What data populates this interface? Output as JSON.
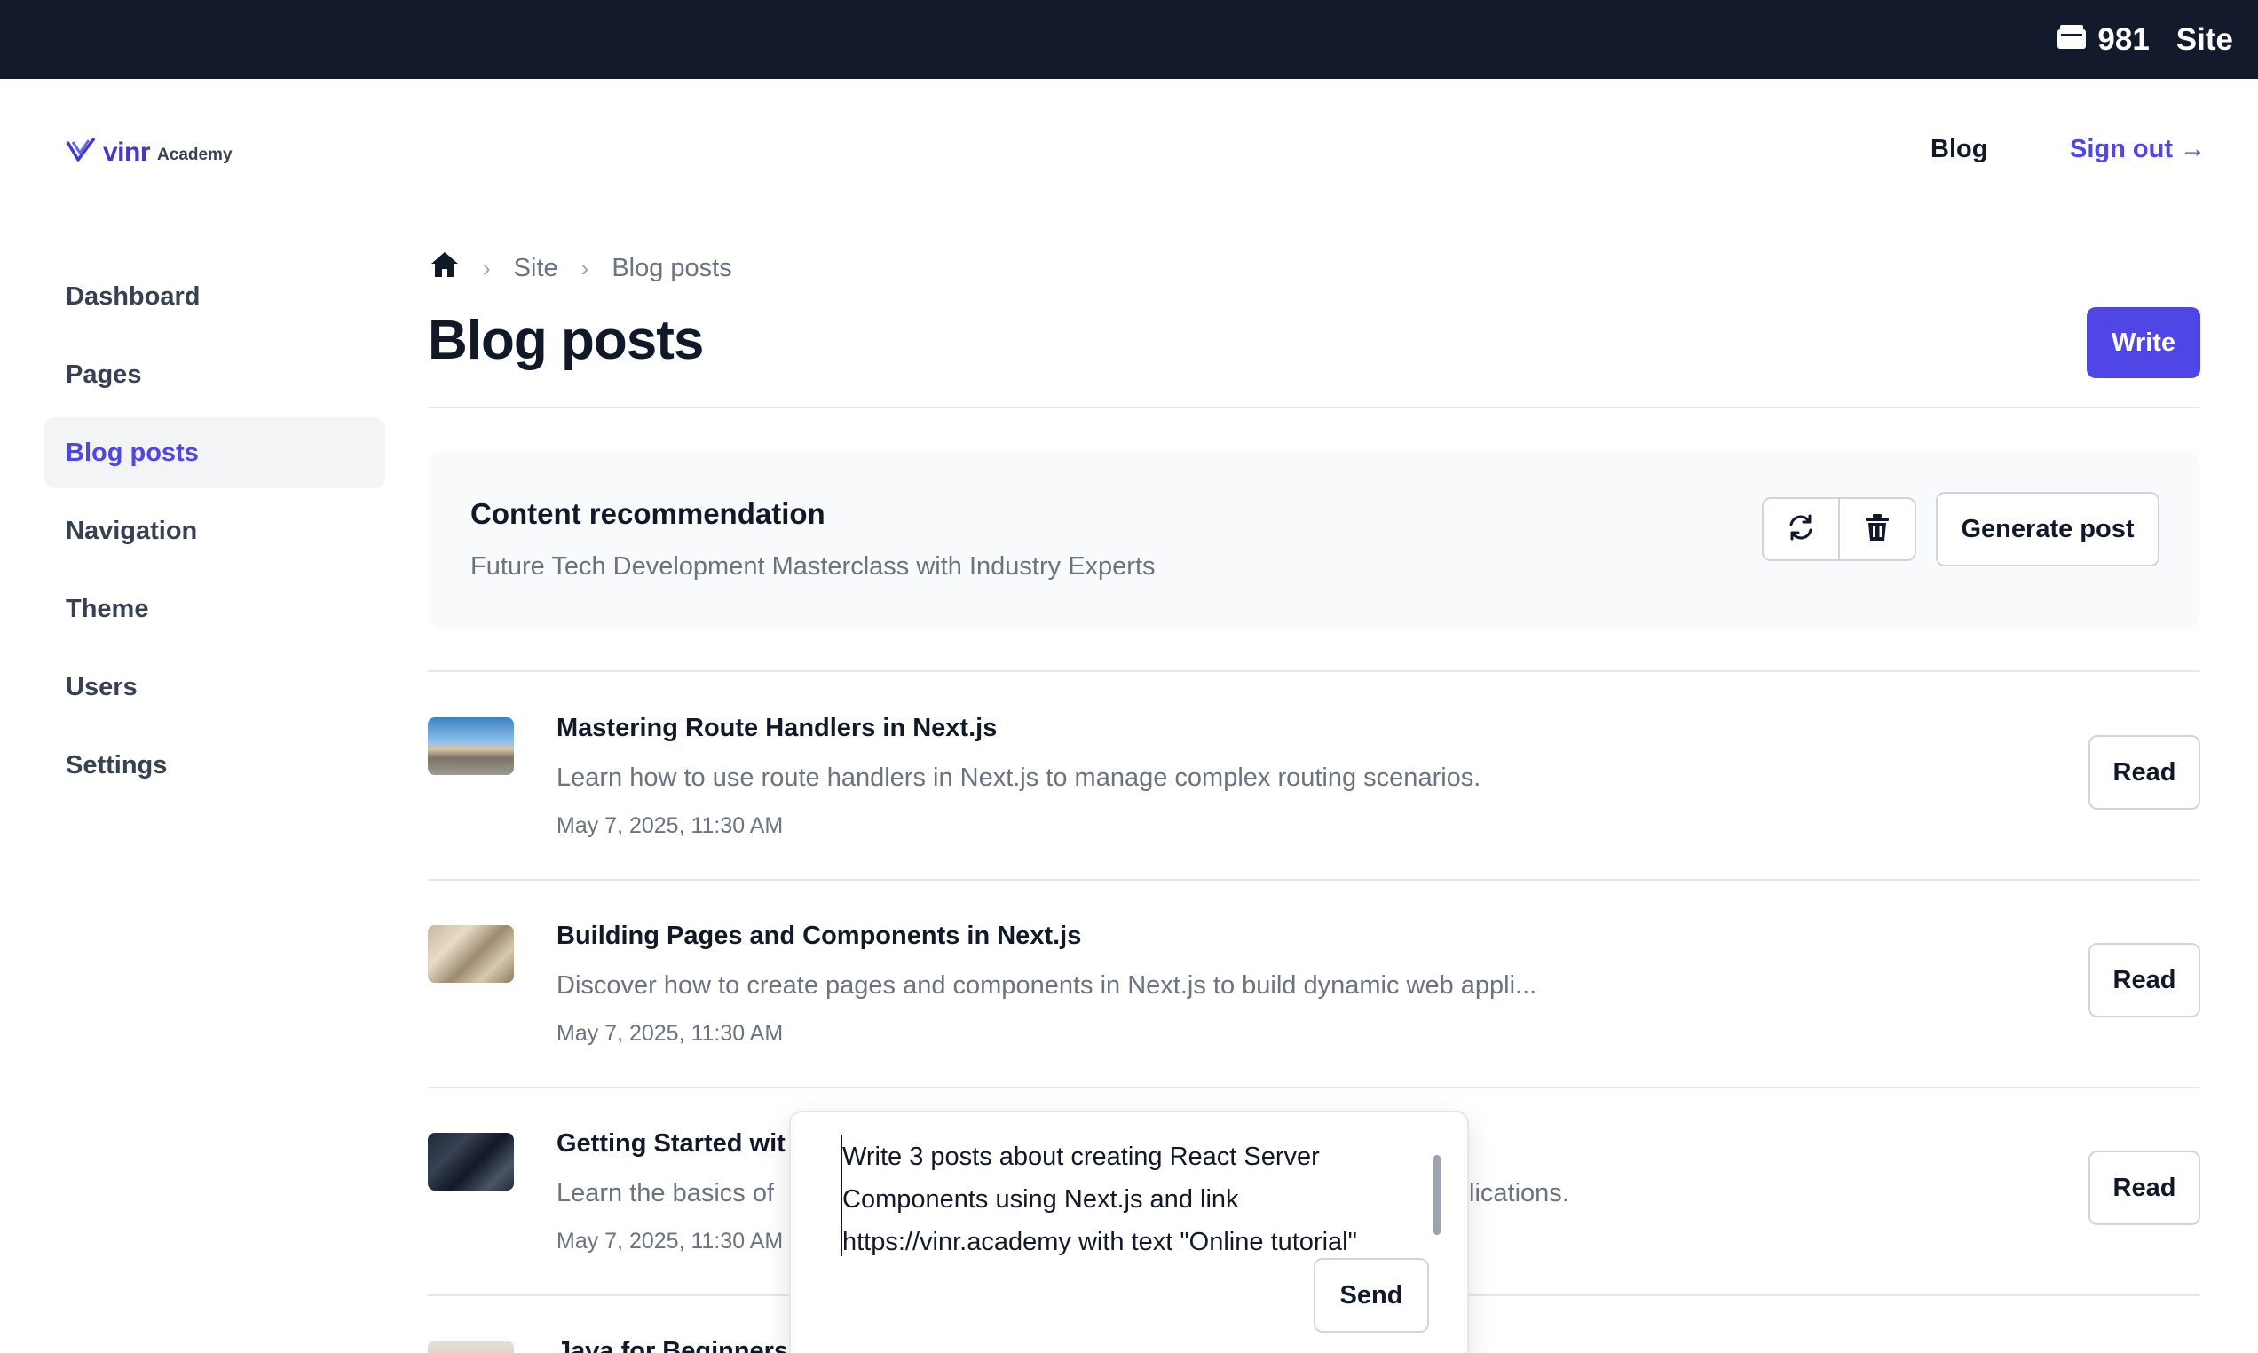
{
  "topbar": {
    "credits": "981",
    "site_label": "Site"
  },
  "header": {
    "logo_word": "vinr",
    "logo_sub": "Academy",
    "nav_blog": "Blog",
    "sign_out": "Sign out →"
  },
  "sidebar": {
    "items": [
      {
        "label": "Dashboard"
      },
      {
        "label": "Pages"
      },
      {
        "label": "Blog posts"
      },
      {
        "label": "Navigation"
      },
      {
        "label": "Theme"
      },
      {
        "label": "Users"
      },
      {
        "label": "Settings"
      }
    ],
    "active": "Blog posts"
  },
  "breadcrumb": {
    "items": [
      "Site",
      "Blog posts"
    ]
  },
  "page": {
    "title": "Blog posts",
    "write_label": "Write"
  },
  "recommendation": {
    "title": "Content recommendation",
    "description": "Future Tech Development Masterclass with Industry Experts",
    "generate_label": "Generate post"
  },
  "posts": [
    {
      "title": "Mastering Route Handlers in Next.js",
      "description": "Learn how to use route handlers in Next.js to manage complex routing scenarios.",
      "date": "May 7, 2025, 11:30 AM",
      "read_label": "Read"
    },
    {
      "title": "Building Pages and Components in Next.js",
      "description": "Discover how to create pages and components in Next.js to build dynamic web appli...",
      "date": "May 7, 2025, 11:30 AM",
      "read_label": "Read"
    },
    {
      "title": "Getting Started wit",
      "description": "Learn the basics of",
      "description_tail": "lications.",
      "date": "May 7, 2025, 11:30 AM",
      "read_label": "Read"
    },
    {
      "title": "Java for Beginners:"
    }
  ],
  "chat": {
    "lines": [
      "Write 3 posts about creating React Server",
      "Components using Next.js and link",
      "https://vinr.academy with text \"Online tutorial\""
    ],
    "send_label": "Send"
  },
  "colors": {
    "accent": "#4f46e5",
    "topbar_bg": "#121a2b",
    "muted_text": "#6b7280"
  }
}
